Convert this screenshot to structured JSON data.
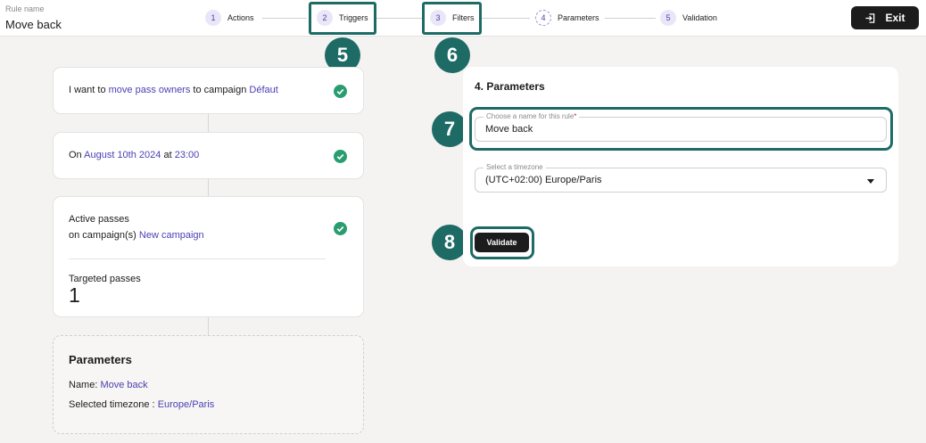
{
  "header": {
    "rule_name_label": "Rule name",
    "rule_name_value": "Move back",
    "exit_label": "Exit"
  },
  "steps": [
    {
      "number": "1",
      "label": "Actions"
    },
    {
      "number": "2",
      "label": "Triggers"
    },
    {
      "number": "3",
      "label": "Filters"
    },
    {
      "number": "4",
      "label": "Parameters"
    },
    {
      "number": "5",
      "label": "Validation"
    }
  ],
  "annotations": [
    "5",
    "6",
    "7",
    "8"
  ],
  "summary": {
    "action": {
      "prefix": "I want to",
      "verb": "move pass owners",
      "middle": "to campaign",
      "campaign": "Défaut"
    },
    "trigger": {
      "prefix": "On",
      "date": "August 10th 2024",
      "middle": "at",
      "time": "23:00"
    },
    "filter": {
      "line1": "Active passes",
      "prefix": "on campaign(s)",
      "campaign": "New campaign",
      "targeted_label": "Targeted passes",
      "targeted_count": "1"
    },
    "parameters": {
      "title": "Parameters",
      "name_label": "Name:",
      "name_value": "Move back",
      "timezone_label": "Selected timezone :",
      "timezone_value": "Europe/Paris"
    }
  },
  "panel": {
    "title": "4. Parameters",
    "name_field": {
      "legend": "Choose a name for this rule",
      "required_mark": "*",
      "value": "Move back"
    },
    "timezone_field": {
      "legend": "Select a timezone",
      "value": "(UTC+02:00) Europe/Paris"
    },
    "validate_label": "Validate"
  },
  "colors": {
    "accent": "#4a3fb3",
    "highlight": "#1e6b66",
    "success": "#2a9d70",
    "dark": "#1c1c1c"
  }
}
